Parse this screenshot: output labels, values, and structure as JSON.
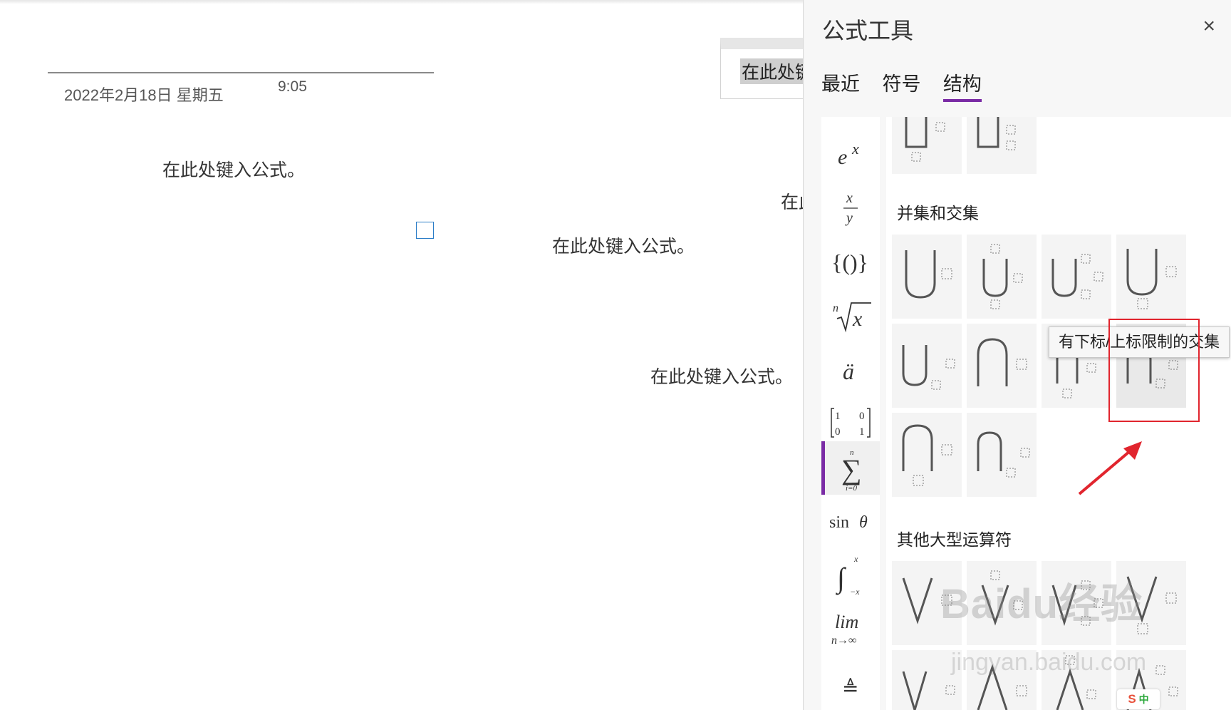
{
  "page": {
    "date": "2022年2月18日 星期五",
    "time": "9:05",
    "equations": [
      "在此处键入公式。",
      "在此",
      "在此处键入公式。",
      "在此处键入公式。"
    ],
    "selected_equation": "在此处键"
  },
  "pane": {
    "title": "公式工具",
    "close_glyph": "×",
    "tabs": [
      "最近",
      "符号",
      "结构"
    ],
    "active_tab": "结构",
    "categories": [
      {
        "icon": "exponent-icon",
        "label": "e^x"
      },
      {
        "icon": "fraction-icon",
        "label": "x/y"
      },
      {
        "icon": "brackets-icon",
        "label": "{()}"
      },
      {
        "icon": "radical-icon",
        "label": "ⁿ√x"
      },
      {
        "icon": "accent-icon",
        "label": "ä"
      },
      {
        "icon": "matrix-icon",
        "label": "[1 0; 0 1]"
      },
      {
        "icon": "large-operator-icon",
        "label": "∑"
      },
      {
        "icon": "function-icon",
        "label": "sin θ"
      },
      {
        "icon": "integral-icon",
        "label": "∫"
      },
      {
        "icon": "limit-icon",
        "label": "lim n→∞"
      },
      {
        "icon": "operator-icon",
        "label": "≜"
      }
    ],
    "active_category": "large-operator-icon",
    "sections": [
      "并集和交集",
      "其他大型运算符"
    ],
    "tooltip": "有下标/上标限制的交集"
  },
  "watermark": {
    "brand": "Baidu经验",
    "url": "jingyan.baidu.com"
  },
  "ime": {
    "logo": "S",
    "mode": "中"
  },
  "colors": {
    "accent": "#7a2ba5",
    "annotation_red": "#e1252e",
    "cursor_blue": "#2b7dc7"
  }
}
